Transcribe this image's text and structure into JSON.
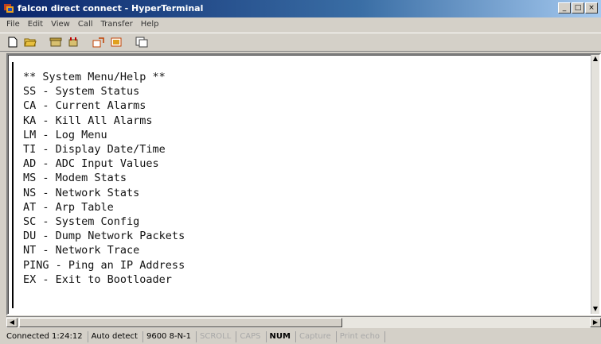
{
  "window": {
    "title": "falcon direct connect - HyperTerminal",
    "minimize_glyph": "_",
    "maximize_glyph": "□",
    "close_glyph": "×"
  },
  "menubar": {
    "items": [
      "File",
      "Edit",
      "View",
      "Call",
      "Transfer",
      "Help"
    ]
  },
  "toolbar": {
    "icons": [
      "new-icon",
      "open-icon",
      "phone-icon",
      "disconnect-icon",
      "send-icon",
      "receive-icon",
      "properties-icon"
    ]
  },
  "terminal": {
    "lines": [
      "** System Menu/Help **",
      "SS - System Status",
      "CA - Current Alarms",
      "KA - Kill All Alarms",
      "LM - Log Menu",
      "TI - Display Date/Time",
      "AD - ADC Input Values",
      "MS - Modem Stats",
      "NS - Network Stats",
      "AT - Arp Table",
      "SC - System Config",
      "DU - Dump Network Packets",
      "NT - Network Trace",
      "PING - Ping an IP Address",
      "EX - Exit to Bootloader"
    ]
  },
  "statusbar": {
    "connected": "Connected 1:24:12",
    "detect": "Auto detect",
    "settings": "9600 8-N-1",
    "scroll": "SCROLL",
    "caps": "CAPS",
    "num": "NUM",
    "capture": "Capture",
    "print_echo": "Print echo"
  },
  "colors": {
    "titlebar_start": "#0a246a",
    "titlebar_end": "#a6caf0",
    "chrome": "#d4d0c8"
  }
}
